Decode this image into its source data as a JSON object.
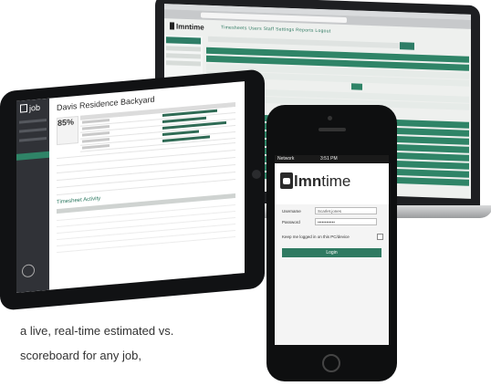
{
  "laptop": {
    "logo": "lmntime",
    "nav": "Timesheets   Users   Staff   Settings   Reports   Logout"
  },
  "tablet": {
    "logo": "job",
    "title": "Davis Residence Backyard",
    "percent": "85%",
    "timesheet_heading": "Timesheet Activity"
  },
  "phone": {
    "network": "Network",
    "time": "3:51 PM",
    "logo_bold": "lmn",
    "logo_rest": "time",
    "username_label": "Username",
    "username_value": "Scarlet.jones",
    "password_label": "Password",
    "password_value": "••••••••••••",
    "keep_logged_label": "Keep me logged in on this PC/device",
    "login_button": "Login"
  },
  "caption": {
    "line1": "a live, real-time estimated vs.",
    "line2": "scoreboard for any job,"
  },
  "colors": {
    "brand_green": "#2f7a62",
    "dark_bezel": "#111214"
  }
}
